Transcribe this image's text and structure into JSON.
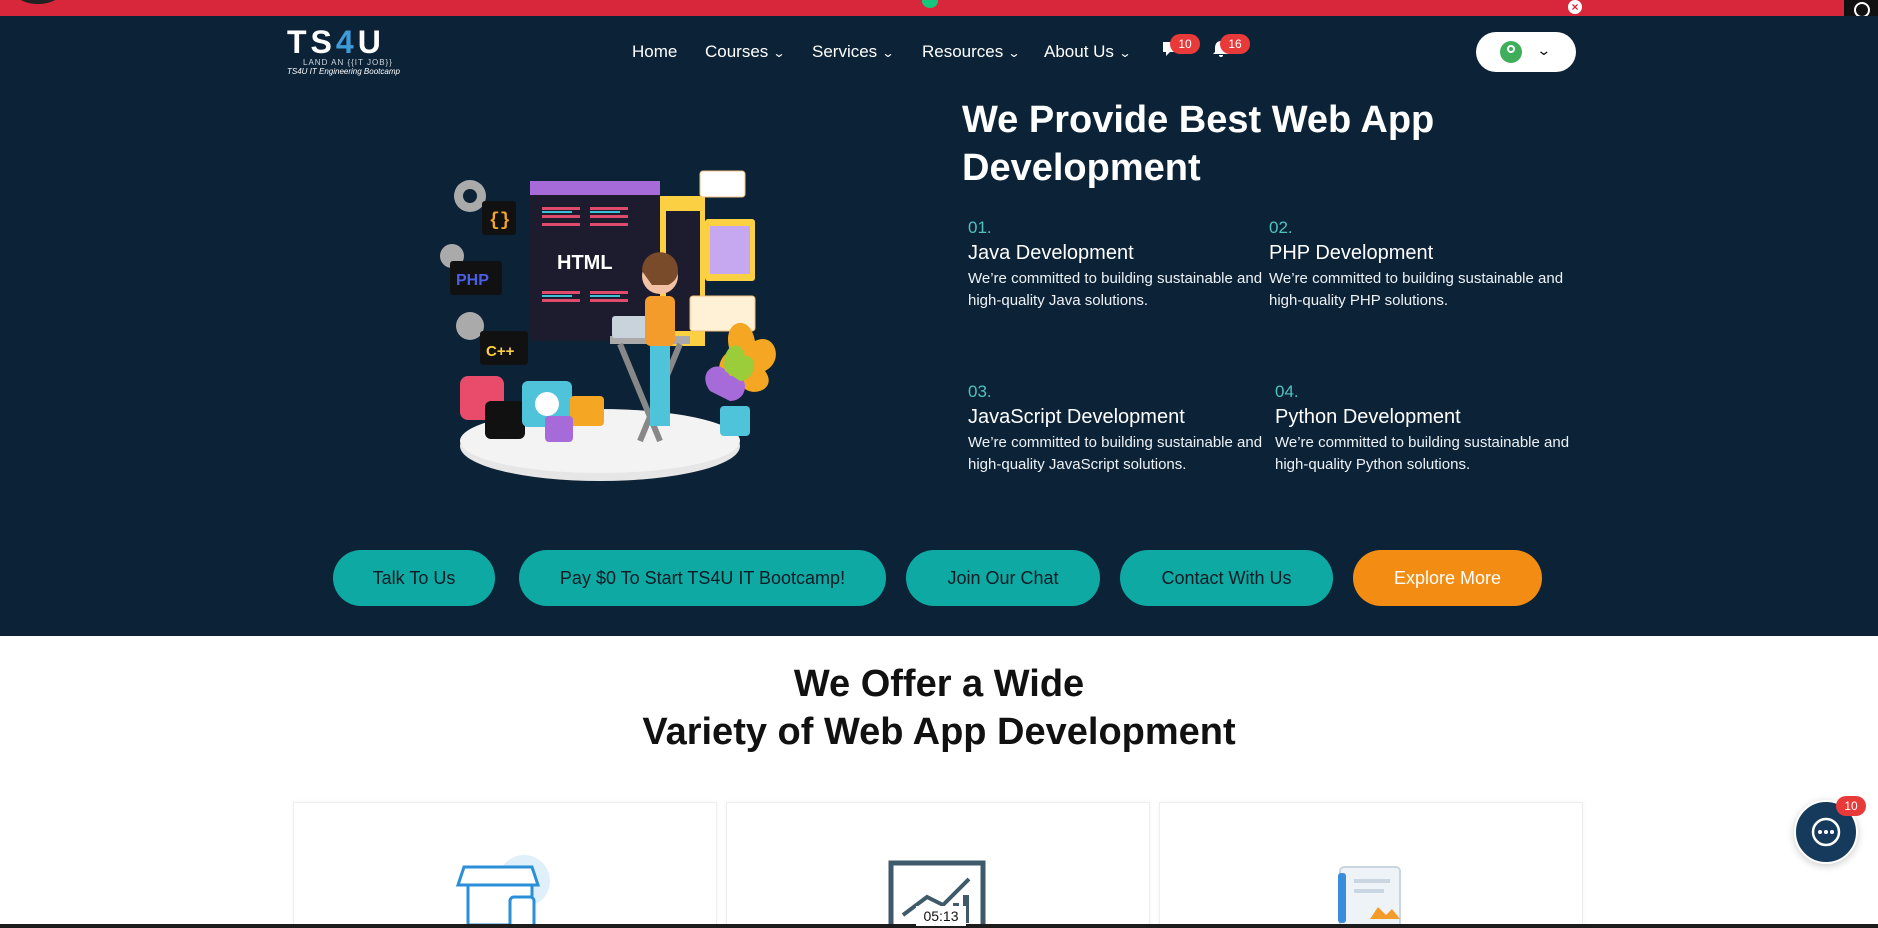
{
  "top_bar": {
    "close_symbol": "×"
  },
  "header": {
    "logo": {
      "main_left": "TS",
      "main_accent": "4",
      "main_right": "U",
      "tagline": "LAND AN {{IT JOB}}",
      "subtitle": "TS4U IT Engineering Bootcamp"
    },
    "nav": [
      {
        "label": "Home",
        "dropdown": false
      },
      {
        "label": "Courses",
        "dropdown": true
      },
      {
        "label": "Services",
        "dropdown": true
      },
      {
        "label": "Resources",
        "dropdown": true
      },
      {
        "label": "About Us",
        "dropdown": true
      }
    ],
    "messages_badge": "10",
    "notifications_badge": "16"
  },
  "hero": {
    "title": "We Provide Best Web App Development",
    "illustration_text": {
      "html": "HTML",
      "php": "PHP",
      "cpp": "C++"
    },
    "services": [
      {
        "number": "01.",
        "name": "Java Development",
        "description": "We’re committed to building sustainable and high-quality Java solutions."
      },
      {
        "number": "02.",
        "name": "PHP Development",
        "description": "We’re committed to building sustainable and high-quality PHP solutions."
      },
      {
        "number": "03.",
        "name": "JavaScript Development",
        "description": "We’re committed to building sustainable and high-quality JavaScript solutions."
      },
      {
        "number": "04.",
        "name": "Python Development",
        "description": "We’re committed to building sustainable and high-quality Python solutions."
      }
    ],
    "buttons": {
      "talk": "Talk To Us",
      "pay": "Pay $0 To Start TS4U IT Bootcamp!",
      "chat": "Join Our Chat",
      "contact": "Contact With Us",
      "explore": "Explore More"
    }
  },
  "section": {
    "title_line1": "We Offer a Wide",
    "title_line2": "Variety of Web App Development"
  },
  "chat_widget_badge": "10",
  "video_time": "05:13",
  "colors": {
    "hero_bg": "#0c2337",
    "teal": "#0fa9a3",
    "orange": "#f28c12",
    "badge_red": "#e93a3a",
    "top_bar": "#d8263a"
  },
  "icons": [
    "chat-bubble-icon",
    "bell-icon",
    "user-avatar-icon",
    "chevron-down-icon",
    "close-icon",
    "store-icon",
    "chart-icon",
    "document-icon",
    "chat-widget-icon"
  ]
}
